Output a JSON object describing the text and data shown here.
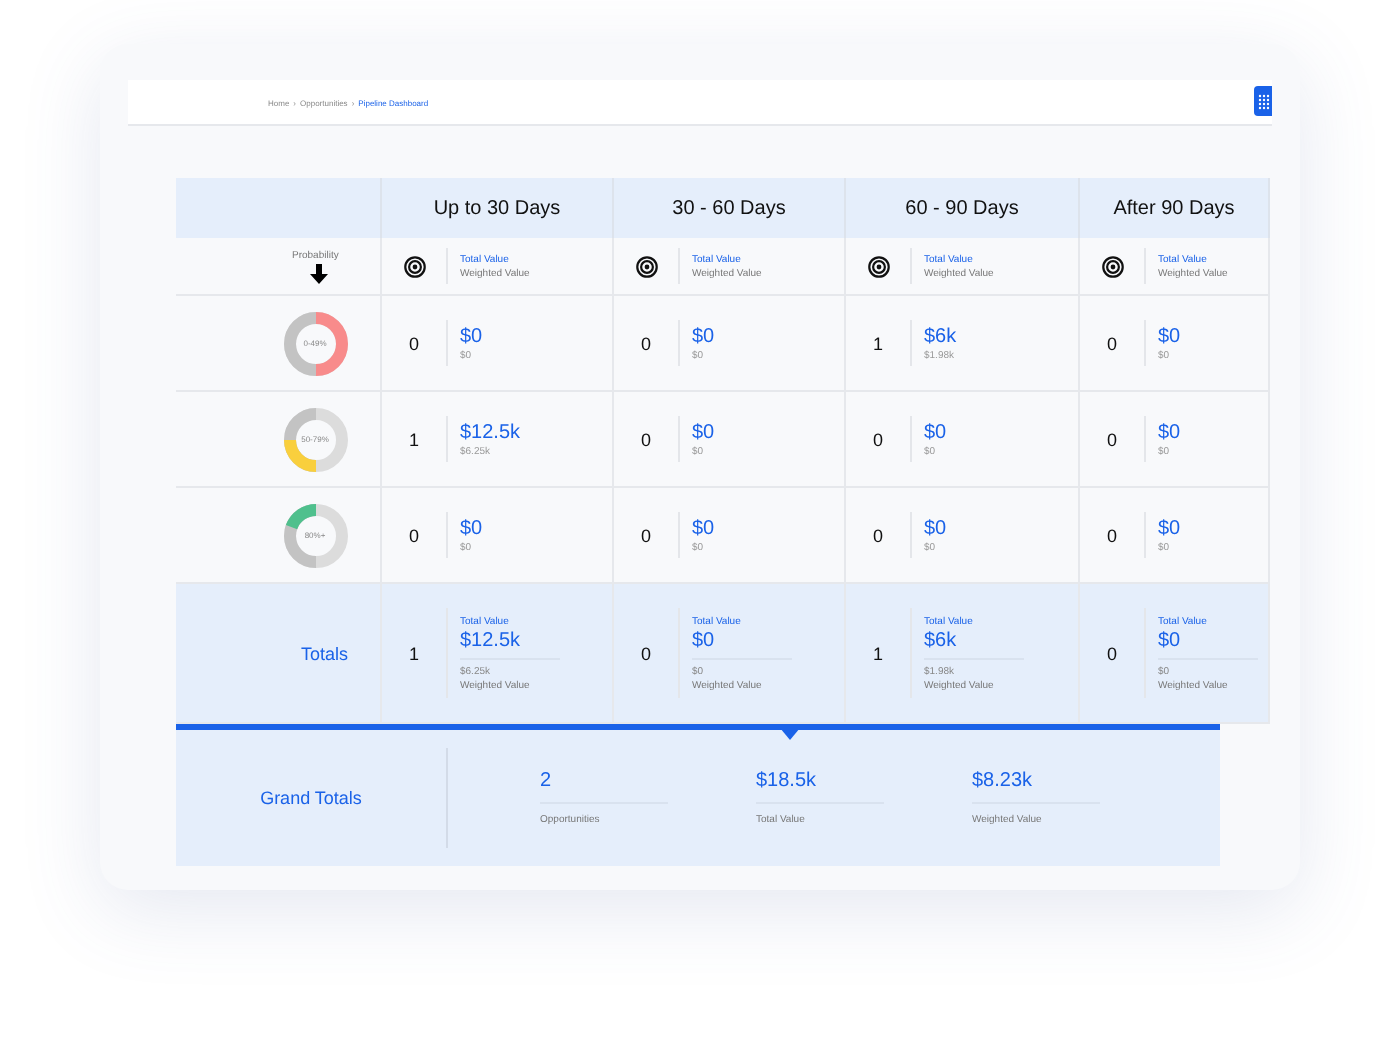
{
  "breadcrumb": [
    {
      "label": "Home",
      "current": false
    },
    {
      "separator": "›",
      "label": "Opportunities",
      "current": false
    },
    {
      "separator": "›",
      "label": "Pipeline Dashboard",
      "current": true
    }
  ],
  "columns": [
    "Up to 30 Days",
    "30 - 60 Days",
    "60 - 90 Days",
    "After 90 Days"
  ],
  "probability_label": "Probability",
  "subheaders": [
    {
      "total_label": "Total Value",
      "weighted_label": "Weighted Value"
    },
    {
      "total_label": "Total Value",
      "weighted_label": "Weighted Value"
    },
    {
      "total_label": "Total Value",
      "weighted_label": "Weighted Value"
    },
    {
      "total_label": "Total Value",
      "weighted_label": "Weighted Value"
    }
  ],
  "rows": [
    {
      "band": "0-49%",
      "color": "#f88b8b",
      "cells": [
        {
          "count": "0",
          "total": "$0",
          "weighted": "$0"
        },
        {
          "count": "0",
          "total": "$0",
          "weighted": "$0"
        },
        {
          "count": "1",
          "total": "$6k",
          "weighted": "$1.98k"
        },
        {
          "count": "0",
          "total": "$0",
          "weighted": "$0"
        }
      ]
    },
    {
      "band": "50-79%",
      "color": "#f9cf3d",
      "cells": [
        {
          "count": "1",
          "total": "$12.5k",
          "weighted": "$6.25k"
        },
        {
          "count": "0",
          "total": "$0",
          "weighted": "$0"
        },
        {
          "count": "0",
          "total": "$0",
          "weighted": "$0"
        },
        {
          "count": "0",
          "total": "$0",
          "weighted": "$0"
        }
      ]
    },
    {
      "band": "80%+",
      "color": "#4fc08d",
      "cells": [
        {
          "count": "0",
          "total": "$0",
          "weighted": "$0"
        },
        {
          "count": "0",
          "total": "$0",
          "weighted": "$0"
        },
        {
          "count": "0",
          "total": "$0",
          "weighted": "$0"
        },
        {
          "count": "0",
          "total": "$0",
          "weighted": "$0"
        }
      ]
    }
  ],
  "totals": {
    "label": "Totals",
    "cells": [
      {
        "count": "1",
        "total_label": "Total Value",
        "total": "$12.5k",
        "weighted": "$6.25k",
        "weighted_label": "Weighted Value"
      },
      {
        "count": "0",
        "total_label": "Total Value",
        "total": "$0",
        "weighted": "$0",
        "weighted_label": "Weighted Value"
      },
      {
        "count": "1",
        "total_label": "Total Value",
        "total": "$6k",
        "weighted": "$1.98k",
        "weighted_label": "Weighted Value"
      },
      {
        "count": "0",
        "total_label": "Total Value",
        "total": "$0",
        "weighted": "$0",
        "weighted_label": "Weighted Value"
      }
    ]
  },
  "grand_totals": {
    "label": "Grand Totals",
    "items": [
      {
        "value": "2",
        "label": "Opportunities"
      },
      {
        "value": "$18.5k",
        "label": "Total Value"
      },
      {
        "value": "$8.23k",
        "label": "Weighted Value"
      }
    ]
  }
}
